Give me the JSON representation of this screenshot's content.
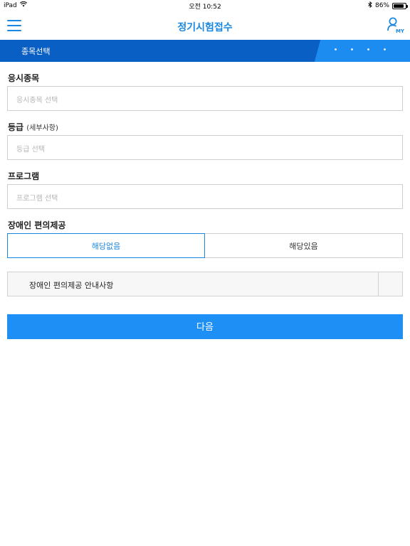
{
  "status_bar": {
    "device": "iPad",
    "time": "오전 10:52",
    "battery_text": "86%",
    "battery_level": 0.86
  },
  "header": {
    "title": "정기시험접수",
    "my_label": "MY"
  },
  "step_bar": {
    "current_step": "종목선택"
  },
  "form": {
    "subject": {
      "label": "응시종목",
      "placeholder": "응시종목 선택"
    },
    "grade": {
      "label": "등급",
      "label_sub": "(세부사항)",
      "placeholder": "등급 선택"
    },
    "program": {
      "label": "프로그램",
      "placeholder": "프로그램 선택"
    },
    "disability": {
      "label": "장애인 편의제공",
      "options": [
        "해당없음",
        "해당있음"
      ],
      "selected": "해당없음",
      "info_text": "장애인 편의제공 안내사항"
    }
  },
  "actions": {
    "next_label": "다음"
  },
  "colors": {
    "accent": "#1a87e0",
    "step_bar": "#0a5fc4",
    "button": "#1e90f5"
  }
}
